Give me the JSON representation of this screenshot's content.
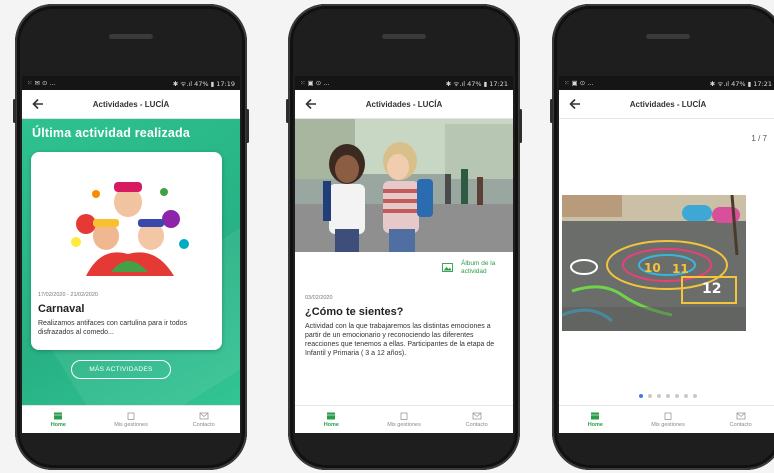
{
  "phones": [
    {
      "status": {
        "left": "⁙ ✉ ⊙ ...",
        "right": "✱ ᯤ.ıl 47% ▮ 17:19"
      },
      "appbar_title": "Actividades - LUCÍA",
      "section_title": "Última actividad realizada",
      "card": {
        "date": "17/02/2020 - 21/02/2020",
        "title": "Carnaval",
        "description": "Realizamos antifaces con cartulina para ir todos disfrazados al comedo..."
      },
      "more_button": "MÁS ACTIVIDADES"
    },
    {
      "status": {
        "left": "⁙ ▣ ⊙ ...",
        "right": "✱ ᯤ.ıl 47% ▮ 17:21"
      },
      "appbar_title": "Actividades - LUCÍA",
      "album_label": "Álbum de la actividad",
      "date": "03/02/2020",
      "title": "¿Cómo te sientes?",
      "description": "Actividad con la que trabajaremos las distintas emociones a partir de un emocionario y reconociendo las diferentes reacciones que tenemos a ellas. Participantes de la etapa de Infantil y Primaria ( 3 a 12 años)."
    },
    {
      "status": {
        "left": "⁙ ▣ ⊙ ...",
        "right": "✱ ᯤ.ıl 47% ▮ 17:21"
      },
      "appbar_title": "Actividades - LUCÍA",
      "page_counter": "1 / 7",
      "pager": {
        "count": 7,
        "active": 1
      }
    }
  ],
  "bottom_nav": {
    "home": "Home",
    "gestiones": "Mis gestiones",
    "contacto": "Contacto"
  },
  "colors": {
    "accent_green": "#2a9d4a",
    "header_green": "#2ec28f",
    "pager_active": "#3d7ee0"
  },
  "icons": [
    "back-arrow-icon",
    "home-icon",
    "folder-icon",
    "mail-icon",
    "photo-album-icon"
  ]
}
